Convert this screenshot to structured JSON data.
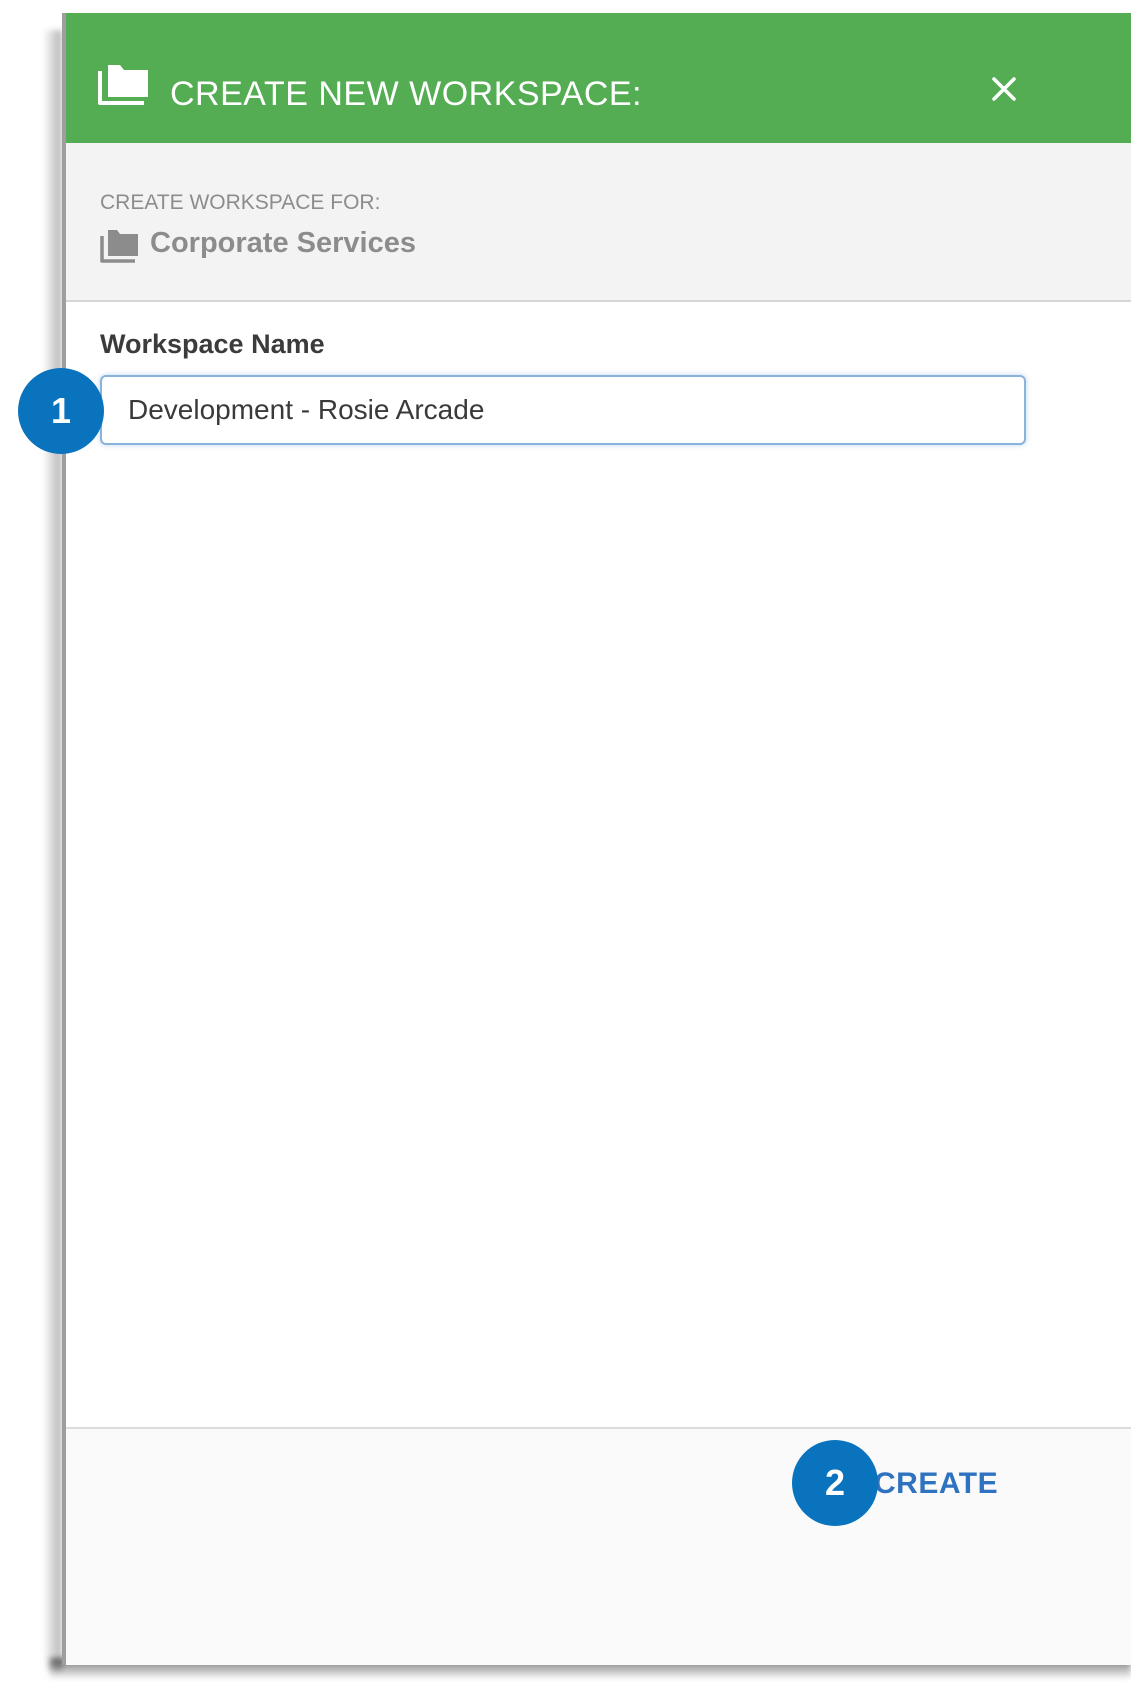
{
  "dialog": {
    "title": "CREATE NEW WORKSPACE:",
    "title_icon": "folder-stack-icon",
    "close_icon": "close-icon",
    "header_color": "#54ac53"
  },
  "context": {
    "label": "CREATE WORKSPACE FOR:",
    "icon": "folder-stack-icon",
    "value": "Corporate Services"
  },
  "form": {
    "workspace_name_label": "Workspace Name",
    "workspace_name_value": "Development - Rosie Arcade"
  },
  "footer": {
    "create_label": "CREATE",
    "create_color": "#2f72c0"
  },
  "callouts": {
    "one": "1",
    "two": "2",
    "color": "#0a73be"
  }
}
